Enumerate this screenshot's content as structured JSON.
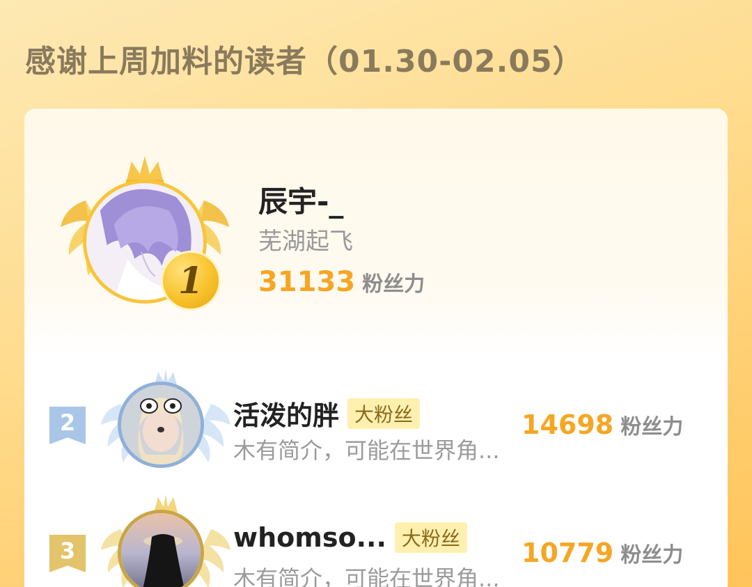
{
  "heading": "感谢上周加料的读者（01.30-02.05）",
  "first": {
    "rank": "1",
    "name": "辰宇-_",
    "subtitle": "芜湖起飞",
    "score": "31133",
    "score_unit": "粉丝力"
  },
  "rows": [
    {
      "rank": "2",
      "name": "活泼的胖",
      "badge": "大粉丝",
      "desc": "木有简介，可能在世界角...",
      "score": "14698",
      "score_unit": "粉丝力"
    },
    {
      "rank": "3",
      "name": "whomso...",
      "badge": "大粉丝",
      "desc": "木有简介，可能在世界角...",
      "score": "10779",
      "score_unit": "粉丝力"
    }
  ],
  "colors": {
    "accent_orange": "#f5a623",
    "rank2_tag": "#a9c6e8",
    "rank3_tag": "#e3c46a",
    "gold_wing": "#f7c64a"
  }
}
